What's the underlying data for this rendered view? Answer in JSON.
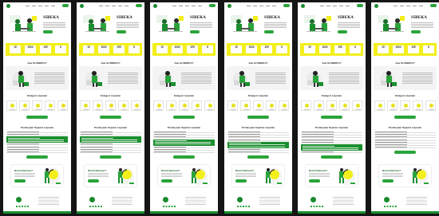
{
  "brand": {
    "name": "SIBEKA",
    "logo_text": "SIBEKA",
    "green": "#2aa43a",
    "dark_green": "#1b8f2f",
    "yellow": "#f2ef1c"
  },
  "stats": [
    {
      "value": "10",
      "label": ""
    },
    {
      "value": "1024",
      "label": ""
    },
    {
      "value": "109",
      "label": ""
    },
    {
      "value": "6",
      "label": ""
    }
  ],
  "sections": {
    "about_title": "Apa Itu SIBEKA?",
    "categories_title": "Kategori Layanan",
    "faq_title": "Pertanyaan Seputar Layanan",
    "help_title": "Butuh Bantuan?"
  },
  "panels": [
    {
      "faq_open_index": 2
    },
    {
      "faq_open_index": 2
    },
    {
      "faq_open_index": 3
    },
    {
      "faq_open_index": 4
    },
    {
      "faq_open_index": 5
    },
    {
      "faq_open_index": -1
    }
  ],
  "icons": [
    "hero-illustration-icon",
    "about-illustration-icon",
    "category-icon",
    "soccer-illustration-icon",
    "social-icon"
  ]
}
